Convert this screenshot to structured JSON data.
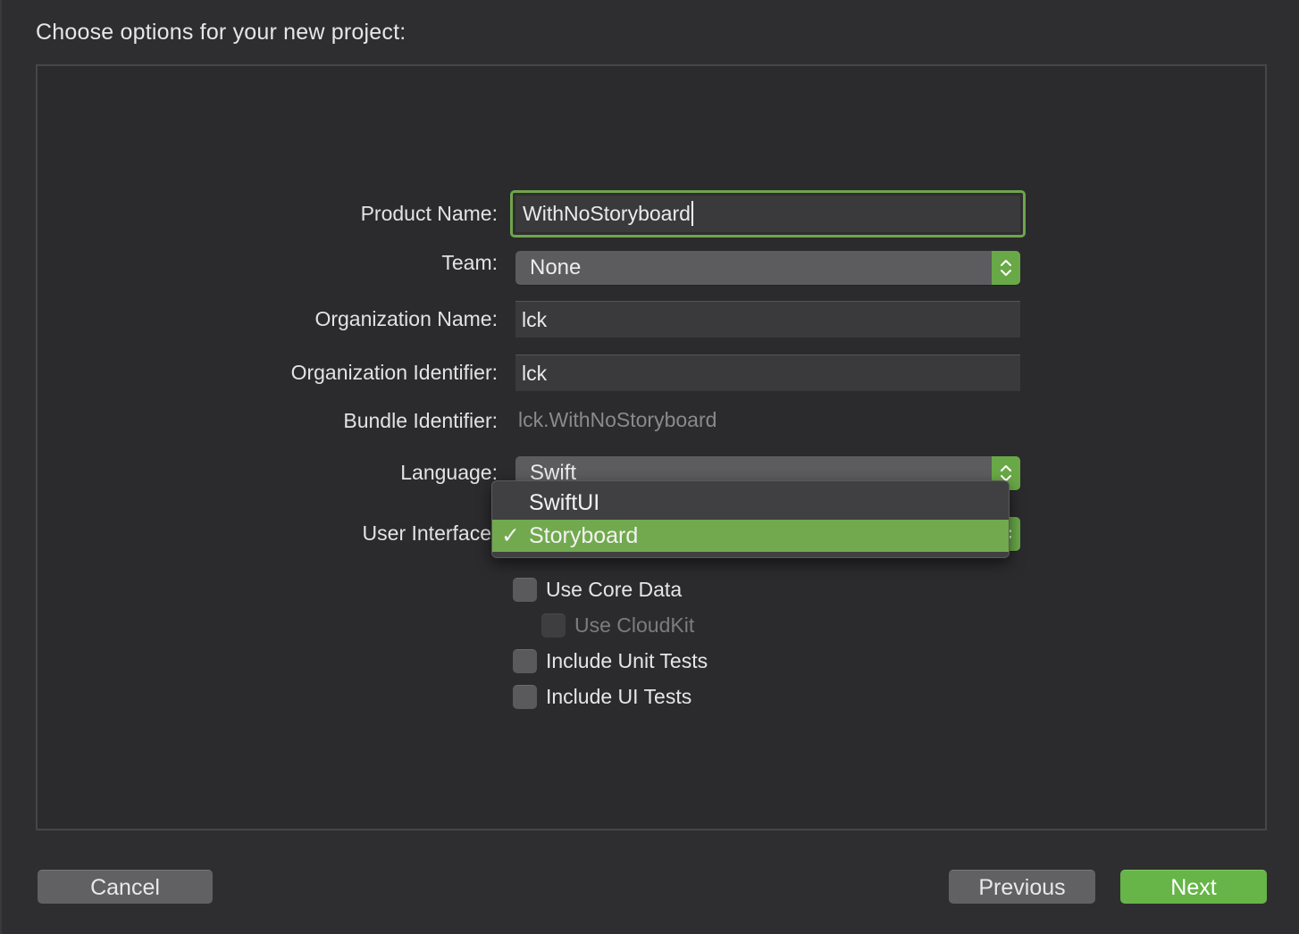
{
  "header": {
    "title": "Choose options for your new project:"
  },
  "form": {
    "product_name": {
      "label": "Product Name:",
      "value": "WithNoStoryboard"
    },
    "team": {
      "label": "Team:",
      "value": "None"
    },
    "organization_name": {
      "label": "Organization Name:",
      "value": "lck"
    },
    "organization_identifier": {
      "label": "Organization Identifier:",
      "value": "lck"
    },
    "bundle_identifier": {
      "label": "Bundle Identifier:",
      "value": "lck.WithNoStoryboard"
    },
    "language": {
      "label": "Language:",
      "value": "Swift"
    },
    "user_interface": {
      "label": "User Interface",
      "options": [
        {
          "label": "SwiftUI",
          "selected": false
        },
        {
          "label": "Storyboard",
          "selected": true
        }
      ],
      "check_glyph": "✓"
    },
    "checkboxes": {
      "core_data": {
        "label": "Use Core Data",
        "checked": false,
        "enabled": true
      },
      "cloudkit": {
        "label": "Use CloudKit",
        "checked": false,
        "enabled": false
      },
      "unit_tests": {
        "label": "Include Unit Tests",
        "checked": false,
        "enabled": true
      },
      "ui_tests": {
        "label": "Include UI Tests",
        "checked": false,
        "enabled": true
      }
    }
  },
  "footer": {
    "cancel_label": "Cancel",
    "previous_label": "Previous",
    "next_label": "Next"
  },
  "colors": {
    "accent": "#6fa54c",
    "primary_button": "#67b448",
    "background": "#2e2e30"
  },
  "icons": {
    "popup_stepper": "up-down-chevron-icon",
    "checkmark": "checkmark-icon"
  }
}
